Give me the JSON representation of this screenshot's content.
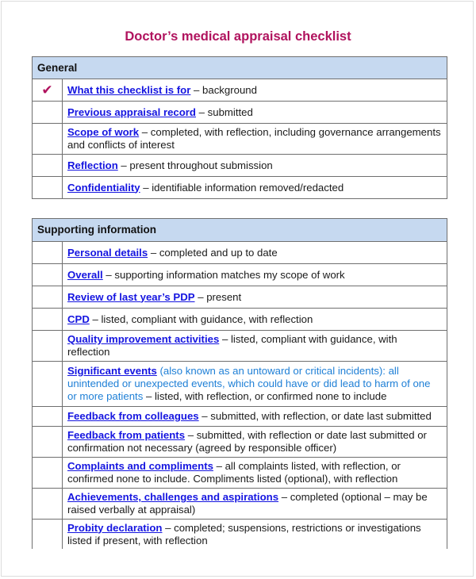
{
  "document": {
    "title": "Doctor’s medical appraisal checklist",
    "colors": {
      "title": "#b0135e",
      "header_bg": "#c6d9f0",
      "link": "#1515e0",
      "note": "#1e7fd6",
      "check": "#b0135e"
    }
  },
  "sections": [
    {
      "heading": "General",
      "items": [
        {
          "checked": true,
          "check_icon": "✔",
          "link": "What this checklist is for",
          "desc": " – background"
        },
        {
          "checked": false,
          "check_icon": "",
          "link": "Previous appraisal record",
          "desc": " – submitted"
        },
        {
          "checked": false,
          "check_icon": "",
          "link": "Scope of work",
          "desc": " – completed, with reflection, including governance arrangements and conflicts of interest"
        },
        {
          "checked": false,
          "check_icon": "",
          "link": "Reflection",
          "desc": " – present throughout submission"
        },
        {
          "checked": false,
          "check_icon": "",
          "link": "Confidentiality",
          "desc": " – identifiable information removed/redacted"
        }
      ]
    },
    {
      "heading": "Supporting information",
      "items": [
        {
          "checked": false,
          "check_icon": "",
          "link": "Personal details",
          "desc": " – completed and up to date"
        },
        {
          "checked": false,
          "check_icon": "",
          "link": "Overall",
          "desc": " – supporting information matches my scope of work"
        },
        {
          "checked": false,
          "check_icon": "",
          "link": "Review of last year’s PDP",
          "desc": " – present"
        },
        {
          "checked": false,
          "check_icon": "",
          "link": "CPD",
          "desc": " – listed, compliant with guidance, with reflection"
        },
        {
          "checked": false,
          "check_icon": "",
          "link": "Quality improvement activities",
          "desc": " – listed, compliant with guidance, with reflection"
        },
        {
          "checked": false,
          "check_icon": "",
          "link": "Significant events",
          "note": " (also known as an untoward or critical incidents): all unintended or unexpected events, which could have or did lead to harm of one or more patients",
          "desc": " – listed, with reflection, or confirmed none to include"
        },
        {
          "checked": false,
          "check_icon": "",
          "link": "Feedback from colleagues",
          "desc": " – submitted, with reflection, or date last submitted"
        },
        {
          "checked": false,
          "check_icon": "",
          "link": "Feedback from patients",
          "desc": " – submitted, with reflection or date last submitted or confirmation not necessary (agreed by responsible officer)"
        },
        {
          "checked": false,
          "check_icon": "",
          "link": "Complaints and compliments",
          "desc": " – all complaints listed, with reflection, or confirmed none to include. Compliments listed (optional), with reflection"
        },
        {
          "checked": false,
          "check_icon": "",
          "link": "Achievements, challenges and aspirations",
          "desc": " – completed (optional – may be raised verbally at appraisal)"
        },
        {
          "checked": false,
          "check_icon": "",
          "link": "Probity declaration",
          "desc": " – completed; suspensions, restrictions or investigations listed if present, with reflection"
        }
      ]
    }
  ]
}
